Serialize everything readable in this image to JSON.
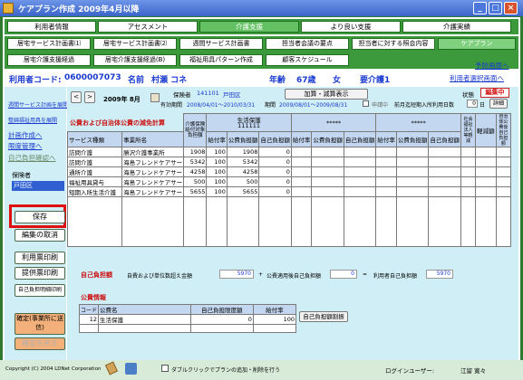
{
  "window": {
    "title": "ケアプラン作成 2009年4月以降"
  },
  "nav_tabs": [
    {
      "label": "利用者情報"
    },
    {
      "label": "アセスメント"
    },
    {
      "label": "介護支援"
    },
    {
      "label": "より良い支援"
    },
    {
      "label": "介護実績"
    }
  ],
  "sub_row1": [
    {
      "label": "居宅サービス計画書⑴"
    },
    {
      "label": "居宅サービス計画書⑵"
    },
    {
      "label": "週間サービス計画書"
    },
    {
      "label": "担当者会議の要点"
    },
    {
      "label": "担当者に対する照会内容"
    },
    {
      "label": "ケアプラン"
    }
  ],
  "sub_row2": [
    {
      "label": "居宅介護支援経過"
    },
    {
      "label": "居宅介護支援経過(B)"
    },
    {
      "label": "福祉用具パターン作成"
    },
    {
      "label": "顧客スケジュール"
    }
  ],
  "yobou_link": "予防画面へ",
  "user": {
    "code_label": "利用者コード:",
    "code": "0600007073",
    "name_label": "名前",
    "name": "村瀬 コネ",
    "age_label": "年齢",
    "age": "67歳",
    "sex": "女",
    "care_level": "要介護1",
    "select_link": "利用者選択画面へ"
  },
  "sidebar": {
    "links": [
      "週間サービス計画を展開",
      "整綿福祉用具を展開",
      "計画作成へ",
      "限度管理へ",
      "自己負担確認へ"
    ],
    "insurer_label": "保険者",
    "insurer_value": "戸田区",
    "buttons": {
      "save": "保存",
      "cancel_edit": "編集の取消",
      "print_usage": "利用票印刷",
      "print_provision": "提供票印刷",
      "print_self_pay": "自己負担明細印刷",
      "confirm": "確定(事業所に送信)",
      "revert": "確定を戻す"
    }
  },
  "header": {
    "prev": "<",
    "next": ">",
    "month": "2009年 8月",
    "calendar_icon": "calendar-icon",
    "insurer_no_label": "保険者",
    "insurer_no": "141101",
    "insurer_name": "戸田区",
    "validity_label": "有効期間",
    "validity": "2008/04/01〜2010/03/31",
    "period_label": "期間",
    "period": "2009/08/01〜2009/08/31",
    "addition_button": "加算・減算表示",
    "applying_label": "申請中",
    "prev_month_label": "前月迄短期入所利用日数",
    "prev_month_days": "0",
    "days_unit": "日",
    "detail_button": "詳細",
    "status_label": "状態",
    "status_value": "編集中"
  },
  "table": {
    "caption": "公費および自治体公費の減免計算",
    "group_headers": [
      "生活保護",
      "*****",
      "*****"
    ],
    "group_code": "111111",
    "columns": [
      "サービス種類",
      "事業所名",
      "介護保険給付対象負担額",
      "給付率",
      "公費負担額",
      "自己負担額",
      "給付率",
      "公費負担額",
      "自己負担額",
      "給付率",
      "公費負担額",
      "自己負担額",
      "社会福祉法人等軽減",
      "軽減額",
      "自治体公費後自己負担額"
    ],
    "rows": [
      [
        "訪問介護",
        "勝沢介護事業所",
        "1908",
        "100",
        "1908",
        "0"
      ],
      [
        "訪問介護",
        "海島フレンドケアサー",
        "5342",
        "100",
        "5342",
        "0"
      ],
      [
        "通所介護",
        "海島フレンドケアサー",
        "4258",
        "100",
        "4258",
        "0"
      ],
      [
        "福祉用具貸与",
        "海島フレンドケアサー",
        "500",
        "100",
        "500",
        "0"
      ],
      [
        "短期入所生活介護",
        "海島フレンドケアサー",
        "5655",
        "100",
        "5655",
        "0"
      ]
    ]
  },
  "self_pay": {
    "section_label": "自己負担額",
    "text1": "自費および単位数超え金額",
    "value1": "5970",
    "plus": "+",
    "text2": "公費適用後自己負担額",
    "value2": "0",
    "equals": "=",
    "text3": "利用者自己負担額",
    "value3": "5970"
  },
  "public": {
    "section_label": "公費情報",
    "headers": [
      "コード",
      "公費名",
      "自己負担限度額",
      "給付率"
    ],
    "rows": [
      [
        "12",
        "生活保護",
        "0",
        "100"
      ]
    ],
    "limit_button": "自己負担額割振"
  },
  "status": {
    "copyright": "Copyright (C) 2004 LDNet Corporation",
    "checkbox_label": "ダブルクリックでプランの追加・削除を行う",
    "login_label": "ログインユーザー:",
    "login_user": "江留 寛々"
  },
  "colors": {
    "frame": "#2f7a2f",
    "nav": "#3c9a3c",
    "panel": "#cfeef5",
    "highlight": "#e01010"
  }
}
